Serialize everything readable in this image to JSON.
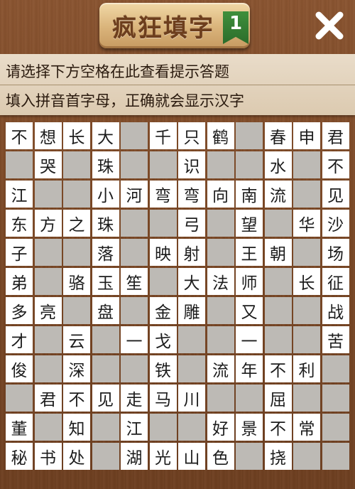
{
  "header": {
    "title": "疯狂填字",
    "level": "1",
    "close_icon": "close-icon"
  },
  "hint": {
    "line1": "请选择下方空格在此查看提示答题",
    "line2": "填入拼音首字母，正确就会显示汉字"
  },
  "grid": {
    "rows": [
      [
        "不",
        "想",
        "长",
        "大",
        "",
        "千",
        "只",
        "鹤",
        "",
        "春",
        "申",
        "君"
      ],
      [
        "",
        "哭",
        "",
        "珠",
        "",
        "",
        "识",
        "",
        "",
        "水",
        "",
        "不"
      ],
      [
        "江",
        "",
        "",
        "小",
        "河",
        "弯",
        "弯",
        "向",
        "南",
        "流",
        "",
        "见"
      ],
      [
        "东",
        "方",
        "之",
        "珠",
        "",
        "",
        "弓",
        "",
        "望",
        "",
        "华",
        "沙"
      ],
      [
        "子",
        "",
        "",
        "落",
        "",
        "映",
        "射",
        "",
        "王",
        "朝",
        "",
        "场"
      ],
      [
        "弟",
        "",
        "骆",
        "玉",
        "笙",
        "",
        "大",
        "法",
        "师",
        "",
        "长",
        "征"
      ],
      [
        "多",
        "亮",
        "",
        "盘",
        "",
        "金",
        "雕",
        "",
        "又",
        "",
        "",
        "战"
      ],
      [
        "才",
        "",
        "云",
        "",
        "一",
        "戈",
        "",
        "",
        "一",
        "",
        "",
        "苦"
      ],
      [
        "俊",
        "",
        "深",
        "",
        "",
        "铁",
        "",
        "流",
        "年",
        "不",
        "利",
        ""
      ],
      [
        "",
        "君",
        "不",
        "见",
        "走",
        "马",
        "川",
        "",
        "",
        "屈",
        "",
        ""
      ],
      [
        "董",
        "",
        "知",
        "",
        "江",
        "",
        "",
        "好",
        "景",
        "不",
        "常",
        ""
      ],
      [
        "秘",
        "书",
        "处",
        "",
        "湖",
        "光",
        "山",
        "色",
        "",
        "挠",
        "",
        ""
      ]
    ],
    "filled": [
      [
        1,
        1,
        1,
        1,
        0,
        1,
        1,
        1,
        0,
        1,
        1,
        1
      ],
      [
        0,
        1,
        0,
        1,
        0,
        0,
        1,
        0,
        0,
        1,
        0,
        1
      ],
      [
        1,
        0,
        0,
        1,
        1,
        1,
        1,
        1,
        1,
        1,
        0,
        1
      ],
      [
        1,
        1,
        1,
        1,
        0,
        0,
        1,
        0,
        1,
        0,
        1,
        1
      ],
      [
        1,
        0,
        0,
        1,
        0,
        1,
        1,
        0,
        1,
        1,
        0,
        1
      ],
      [
        1,
        0,
        1,
        1,
        1,
        0,
        1,
        1,
        1,
        0,
        1,
        1
      ],
      [
        1,
        1,
        0,
        1,
        0,
        1,
        1,
        0,
        1,
        0,
        0,
        1
      ],
      [
        1,
        0,
        1,
        0,
        1,
        1,
        0,
        0,
        1,
        0,
        0,
        1
      ],
      [
        1,
        0,
        1,
        0,
        0,
        1,
        0,
        1,
        1,
        1,
        1,
        0
      ],
      [
        0,
        1,
        1,
        1,
        1,
        1,
        1,
        0,
        0,
        1,
        0,
        0
      ],
      [
        1,
        0,
        1,
        0,
        1,
        0,
        0,
        1,
        1,
        1,
        1,
        0
      ],
      [
        1,
        1,
        1,
        0,
        1,
        1,
        1,
        1,
        0,
        1,
        0,
        0
      ]
    ]
  }
}
